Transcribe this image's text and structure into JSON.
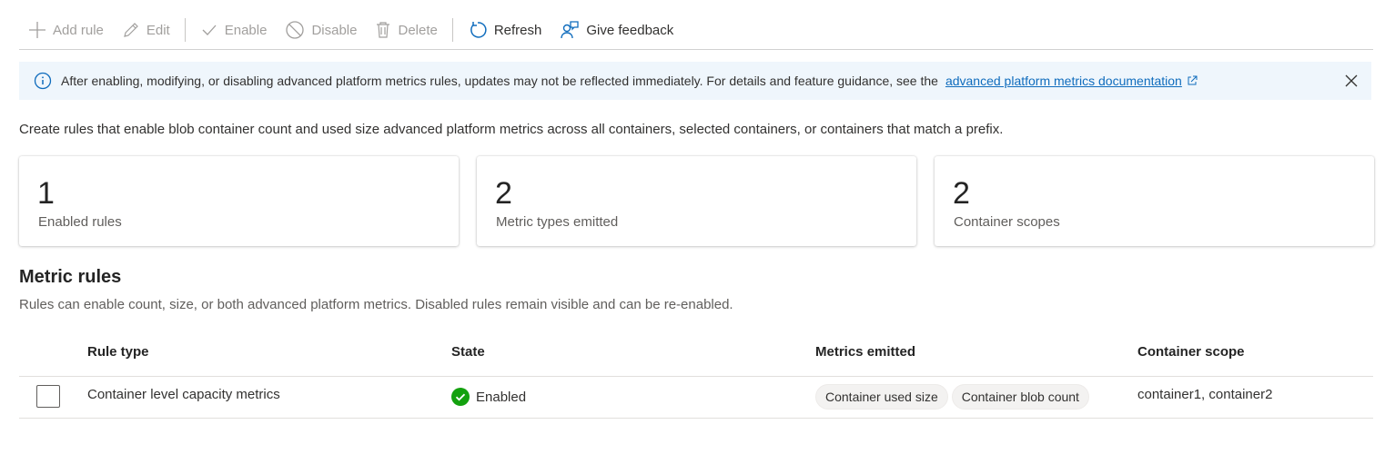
{
  "toolbar": {
    "add_rule": "Add rule",
    "edit": "Edit",
    "enable": "Enable",
    "disable": "Disable",
    "delete": "Delete",
    "refresh": "Refresh",
    "give_feedback": "Give feedback"
  },
  "banner": {
    "text": "After enabling, modifying, or disabling advanced platform metrics rules, updates may not be reflected immediately. For details and feature guidance, see the",
    "link": "advanced platform metrics documentation"
  },
  "description": "Create rules that enable blob container count and used size advanced platform metrics across all containers, selected containers, or containers that match a prefix.",
  "cards": [
    {
      "value": "1",
      "label": "Enabled rules"
    },
    {
      "value": "2",
      "label": "Metric types emitted"
    },
    {
      "value": "2",
      "label": "Container scopes"
    }
  ],
  "section": {
    "title": "Metric rules",
    "description": "Rules can enable count, size, or both advanced platform metrics. Disabled rules remain visible and can be re-enabled."
  },
  "table": {
    "headers": [
      "Rule type",
      "State",
      "Metrics emitted",
      "Container scope"
    ],
    "rows": [
      {
        "rule_type": "Container level capacity metrics",
        "state": "Enabled",
        "metrics": [
          "Container used size",
          "Container blob count"
        ],
        "scope": "container1, container2"
      }
    ]
  },
  "colors": {
    "accent": "#0f6cbd",
    "banner_bg": "#eff6fc",
    "success": "#13a10e",
    "disabled_text": "#a19f9d"
  }
}
